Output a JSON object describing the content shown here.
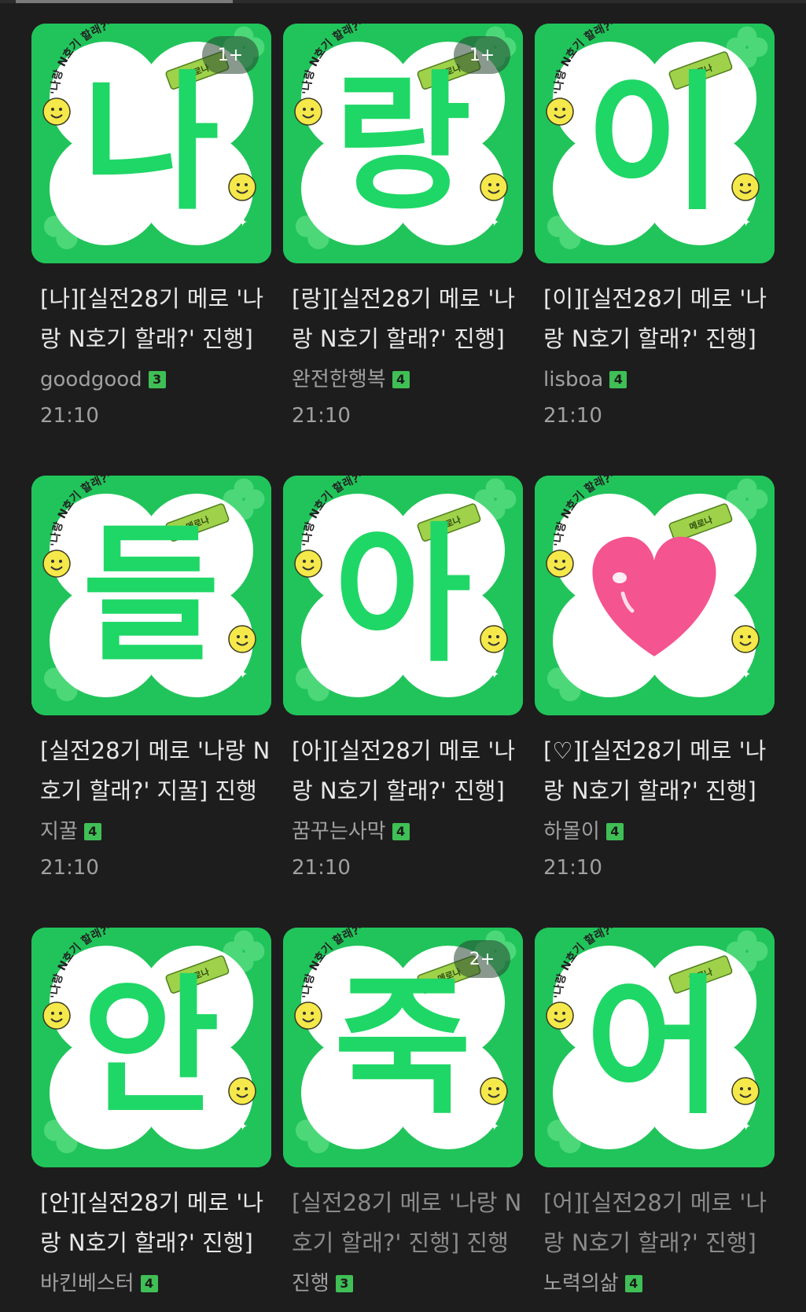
{
  "colors": {
    "background": "#1d1d1d",
    "thumb_green": "#21c45a",
    "glyph_green": "#1fd766",
    "heart_pink": "#f4548f",
    "smiley_yellow": "#f5e84a",
    "new_dot": "#e05545",
    "level_badge": "#3fbf55"
  },
  "posts": [
    {
      "glyph": "나",
      "badge": "1+",
      "title": "[나][실전28기 메로 '나랑 N호기 할래?' 진행]",
      "author": "goodgood",
      "level": "3",
      "time": "21:10",
      "unread": true
    },
    {
      "glyph": "랑",
      "badge": "1+",
      "title": "[랑][실전28기 메로 '나랑 N호기 할래?' 진행]",
      "author": "완전한행복",
      "level": "4",
      "time": "21:10",
      "unread": true
    },
    {
      "glyph": "이",
      "badge": "",
      "title": "[이][실전28기 메로 '나랑 N호기 할래?' 진행]",
      "author": "lisboa",
      "level": "4",
      "time": "21:10",
      "unread": true
    },
    {
      "glyph": "들",
      "badge": "",
      "title": "[실전28기 메로 '나랑 N호기 할래?' 지꿀] 진행",
      "author": "지꿀",
      "level": "4",
      "time": "21:10",
      "unread": true
    },
    {
      "glyph": "아",
      "badge": "",
      "title": "[아][실전28기 메로 '나랑 N호기 할래?' 진행]",
      "author": "꿈꾸는사막",
      "level": "4",
      "time": "21:10",
      "unread": true
    },
    {
      "glyph": "♥",
      "badge": "",
      "title": "[♡][실전28기 메로 '나랑 N호기 할래?' 진행]",
      "author": "하몰이",
      "level": "4",
      "time": "21:10",
      "unread": true
    },
    {
      "glyph": "안",
      "badge": "",
      "title": "[안][실전28기 메로 '나랑 N호기 할래?' 진행]",
      "author": "바킨베스터",
      "level": "4",
      "time": "",
      "unread": true
    },
    {
      "glyph": "죽",
      "badge": "2+",
      "title": "[실전28기 메로 '나랑 N호기 할래?' 진행] 진행",
      "author": "진행",
      "level": "3",
      "time": "",
      "unread": false
    },
    {
      "glyph": "어",
      "badge": "",
      "title": "[어][실전28기 메로 '나랑 N호기 할래?' 진행]",
      "author": "노력의삶",
      "level": "4",
      "time": "",
      "unread": false
    }
  ],
  "thumb_text": {
    "arc_text": "메로 '나랑 N호기 할래?'",
    "bar_label": "메로나"
  }
}
